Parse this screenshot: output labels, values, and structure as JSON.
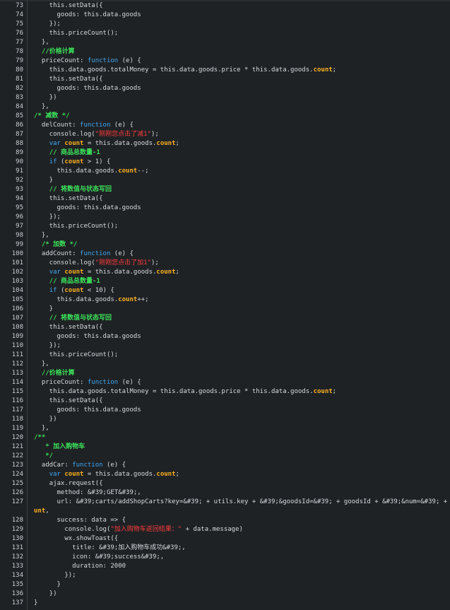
{
  "editor": {
    "lines": [
      {
        "n": "73",
        "segs": [
          {
            "t": "    this.setData({",
            "c": "p"
          }
        ]
      },
      {
        "n": "74",
        "segs": [
          {
            "t": "      goods: this.data.goods",
            "c": "p"
          }
        ]
      },
      {
        "n": "75",
        "segs": [
          {
            "t": "    });",
            "c": "p"
          }
        ]
      },
      {
        "n": "76",
        "segs": [
          {
            "t": "    this.priceCount();",
            "c": "p"
          }
        ]
      },
      {
        "n": "77",
        "segs": [
          {
            "t": "  },",
            "c": "p"
          }
        ]
      },
      {
        "n": "78",
        "segs": [
          {
            "t": "  ",
            "c": "p"
          },
          {
            "t": "//价格计算",
            "c": "c"
          }
        ]
      },
      {
        "n": "79",
        "segs": [
          {
            "t": "  priceCount: ",
            "c": "p"
          },
          {
            "t": "function",
            "c": "k"
          },
          {
            "t": " (e) {",
            "c": "p"
          }
        ]
      },
      {
        "n": "80",
        "segs": [
          {
            "t": "    this.data.goods.totalMoney = this.data.goods.price * this.data.goods.",
            "c": "p"
          },
          {
            "t": "count",
            "c": "v"
          },
          {
            "t": ";",
            "c": "p"
          }
        ]
      },
      {
        "n": "81",
        "segs": [
          {
            "t": "    this.setData({",
            "c": "p"
          }
        ]
      },
      {
        "n": "82",
        "segs": [
          {
            "t": "      goods: this.data.goods",
            "c": "p"
          }
        ]
      },
      {
        "n": "83",
        "segs": [
          {
            "t": "    })",
            "c": "p"
          }
        ]
      },
      {
        "n": "84",
        "segs": [
          {
            "t": "  },",
            "c": "p"
          }
        ]
      },
      {
        "n": "85",
        "segs": [
          {
            "t": "/* 减数 */",
            "c": "c"
          }
        ]
      },
      {
        "n": "86",
        "segs": [
          {
            "t": "  delCount: ",
            "c": "p"
          },
          {
            "t": "function",
            "c": "k"
          },
          {
            "t": " (e) {",
            "c": "p"
          }
        ]
      },
      {
        "n": "87",
        "segs": [
          {
            "t": "    console.log(",
            "c": "p"
          },
          {
            "t": "\"刚刚您点击了减1\"",
            "c": "s"
          },
          {
            "t": ");",
            "c": "p"
          }
        ]
      },
      {
        "n": "88",
        "segs": [
          {
            "t": "    ",
            "c": "p"
          },
          {
            "t": "var",
            "c": "k"
          },
          {
            "t": " ",
            "c": "p"
          },
          {
            "t": "count",
            "c": "v"
          },
          {
            "t": " = this.data.goods.",
            "c": "p"
          },
          {
            "t": "count",
            "c": "v"
          },
          {
            "t": ";",
            "c": "p"
          }
        ]
      },
      {
        "n": "89",
        "segs": [
          {
            "t": "    ",
            "c": "p"
          },
          {
            "t": "// 商品总数量-1",
            "c": "c"
          }
        ]
      },
      {
        "n": "90",
        "segs": [
          {
            "t": "    ",
            "c": "p"
          },
          {
            "t": "if",
            "c": "k"
          },
          {
            "t": " (",
            "c": "p"
          },
          {
            "t": "count",
            "c": "v"
          },
          {
            "t": " > 1) {",
            "c": "p"
          }
        ]
      },
      {
        "n": "91",
        "segs": [
          {
            "t": "      this.data.goods.",
            "c": "p"
          },
          {
            "t": "count",
            "c": "v"
          },
          {
            "t": "--;",
            "c": "p"
          }
        ]
      },
      {
        "n": "92",
        "segs": [
          {
            "t": "    }",
            "c": "p"
          }
        ]
      },
      {
        "n": "93",
        "segs": [
          {
            "t": "    ",
            "c": "p"
          },
          {
            "t": "// 将数值与状态写回",
            "c": "c"
          }
        ]
      },
      {
        "n": "94",
        "segs": [
          {
            "t": "    this.setData({",
            "c": "p"
          }
        ]
      },
      {
        "n": "95",
        "segs": [
          {
            "t": "      goods: this.data.goods",
            "c": "p"
          }
        ]
      },
      {
        "n": "96",
        "segs": [
          {
            "t": "    });",
            "c": "p"
          }
        ]
      },
      {
        "n": "97",
        "segs": [
          {
            "t": "    this.priceCount();",
            "c": "p"
          }
        ]
      },
      {
        "n": "98",
        "segs": [
          {
            "t": "  },",
            "c": "p"
          }
        ]
      },
      {
        "n": "99",
        "segs": [
          {
            "t": "  ",
            "c": "p"
          },
          {
            "t": "/* 加数 */",
            "c": "c"
          }
        ]
      },
      {
        "n": "100",
        "segs": [
          {
            "t": "  addCount: ",
            "c": "p"
          },
          {
            "t": "function",
            "c": "k"
          },
          {
            "t": " (e) {",
            "c": "p"
          }
        ]
      },
      {
        "n": "101",
        "segs": [
          {
            "t": "    console.log(",
            "c": "p"
          },
          {
            "t": "\"刚刚您点击了加1\"",
            "c": "s"
          },
          {
            "t": ");",
            "c": "p"
          }
        ]
      },
      {
        "n": "102",
        "segs": [
          {
            "t": "    ",
            "c": "p"
          },
          {
            "t": "var",
            "c": "k"
          },
          {
            "t": " ",
            "c": "p"
          },
          {
            "t": "count",
            "c": "v"
          },
          {
            "t": " = this.data.goods.",
            "c": "p"
          },
          {
            "t": "count",
            "c": "v"
          },
          {
            "t": ";",
            "c": "p"
          }
        ]
      },
      {
        "n": "103",
        "segs": [
          {
            "t": "    ",
            "c": "p"
          },
          {
            "t": "// 商品总数量-1",
            "c": "c"
          }
        ]
      },
      {
        "n": "104",
        "segs": [
          {
            "t": "    ",
            "c": "p"
          },
          {
            "t": "if",
            "c": "k"
          },
          {
            "t": " (",
            "c": "p"
          },
          {
            "t": "count",
            "c": "v"
          },
          {
            "t": " < 10) {",
            "c": "p"
          }
        ]
      },
      {
        "n": "105",
        "segs": [
          {
            "t": "      this.data.goods.",
            "c": "p"
          },
          {
            "t": "count",
            "c": "v"
          },
          {
            "t": "++;",
            "c": "p"
          }
        ]
      },
      {
        "n": "106",
        "segs": [
          {
            "t": "    }",
            "c": "p"
          }
        ]
      },
      {
        "n": "107",
        "segs": [
          {
            "t": "    ",
            "c": "p"
          },
          {
            "t": "// 将数值与状态写回",
            "c": "c"
          }
        ]
      },
      {
        "n": "108",
        "segs": [
          {
            "t": "    this.setData({",
            "c": "p"
          }
        ]
      },
      {
        "n": "109",
        "segs": [
          {
            "t": "      goods: this.data.goods",
            "c": "p"
          }
        ]
      },
      {
        "n": "110",
        "segs": [
          {
            "t": "    });",
            "c": "p"
          }
        ]
      },
      {
        "n": "111",
        "segs": [
          {
            "t": "    this.priceCount();",
            "c": "p"
          }
        ]
      },
      {
        "n": "112",
        "segs": [
          {
            "t": "  },",
            "c": "p"
          }
        ]
      },
      {
        "n": "113",
        "segs": [
          {
            "t": "  ",
            "c": "p"
          },
          {
            "t": "//价格计算",
            "c": "c"
          }
        ]
      },
      {
        "n": "114",
        "segs": [
          {
            "t": "  priceCount: ",
            "c": "p"
          },
          {
            "t": "function",
            "c": "k"
          },
          {
            "t": " (e) {",
            "c": "p"
          }
        ]
      },
      {
        "n": "115",
        "segs": [
          {
            "t": "    this.data.goods.totalMoney = this.data.goods.price * this.data.goods.",
            "c": "p"
          },
          {
            "t": "count",
            "c": "v"
          },
          {
            "t": ";",
            "c": "p"
          }
        ]
      },
      {
        "n": "116",
        "segs": [
          {
            "t": "    this.setData({",
            "c": "p"
          }
        ]
      },
      {
        "n": "117",
        "segs": [
          {
            "t": "      goods: this.data.goods",
            "c": "p"
          }
        ]
      },
      {
        "n": "118",
        "segs": [
          {
            "t": "    })",
            "c": "p"
          }
        ]
      },
      {
        "n": "119",
        "segs": [
          {
            "t": "  },",
            "c": "p"
          }
        ]
      },
      {
        "n": "120",
        "segs": [
          {
            "t": "/**",
            "c": "c"
          }
        ]
      },
      {
        "n": "121",
        "segs": [
          {
            "t": "   * 加入购物车",
            "c": "c"
          }
        ]
      },
      {
        "n": "122",
        "segs": [
          {
            "t": "   */",
            "c": "c"
          }
        ]
      },
      {
        "n": "123",
        "segs": [
          {
            "t": "  addCar: ",
            "c": "p"
          },
          {
            "t": "function",
            "c": "k"
          },
          {
            "t": " (e) {",
            "c": "p"
          }
        ]
      },
      {
        "n": "124",
        "segs": [
          {
            "t": "    ",
            "c": "p"
          },
          {
            "t": "var",
            "c": "k"
          },
          {
            "t": " ",
            "c": "p"
          },
          {
            "t": "count",
            "c": "v"
          },
          {
            "t": " = this.data.goods.",
            "c": "p"
          },
          {
            "t": "count",
            "c": "v"
          },
          {
            "t": ";",
            "c": "p"
          }
        ]
      },
      {
        "n": "125",
        "segs": [
          {
            "t": "    ajax.request({",
            "c": "p"
          }
        ]
      },
      {
        "n": "126",
        "segs": [
          {
            "t": "      method: &#39;GET&#39;,",
            "c": "p"
          }
        ]
      },
      {
        "n": "127",
        "segs": [
          {
            "t": "      url: &#39;carts/addShopCarts?key=&#39; + utils.key + &#39;&goodsId=&#39; + goodsId + &#39;&num=&#39; + ",
            "c": "p"
          },
          {
            "t": "co",
            "c": "v"
          }
        ]
      },
      {
        "n": "",
        "segs": [
          {
            "t": "unt",
            "c": "v"
          },
          {
            "t": ",",
            "c": "p"
          }
        ],
        "cont": true
      },
      {
        "n": "128",
        "segs": [
          {
            "t": "      success: data => {",
            "c": "p"
          }
        ]
      },
      {
        "n": "129",
        "segs": [
          {
            "t": "        console.log(",
            "c": "p"
          },
          {
            "t": "\"加入购物车返回结果：\"",
            "c": "s"
          },
          {
            "t": " + data.message)",
            "c": "p"
          }
        ]
      },
      {
        "n": "130",
        "segs": [
          {
            "t": "        wx.showToast({",
            "c": "p"
          }
        ]
      },
      {
        "n": "131",
        "segs": [
          {
            "t": "          title: &#39;加入购物车成功&#39;,",
            "c": "p"
          }
        ]
      },
      {
        "n": "132",
        "segs": [
          {
            "t": "          icon: &#39;success&#39;,",
            "c": "p"
          }
        ]
      },
      {
        "n": "133",
        "segs": [
          {
            "t": "          duration: 2000",
            "c": "p"
          }
        ]
      },
      {
        "n": "134",
        "segs": [
          {
            "t": "        });",
            "c": "p"
          }
        ]
      },
      {
        "n": "135",
        "segs": [
          {
            "t": "      }",
            "c": "p"
          }
        ]
      },
      {
        "n": "136",
        "segs": [
          {
            "t": "    })",
            "c": "p"
          }
        ]
      },
      {
        "n": "137",
        "segs": [
          {
            "t": "}",
            "c": "p"
          }
        ]
      }
    ]
  }
}
